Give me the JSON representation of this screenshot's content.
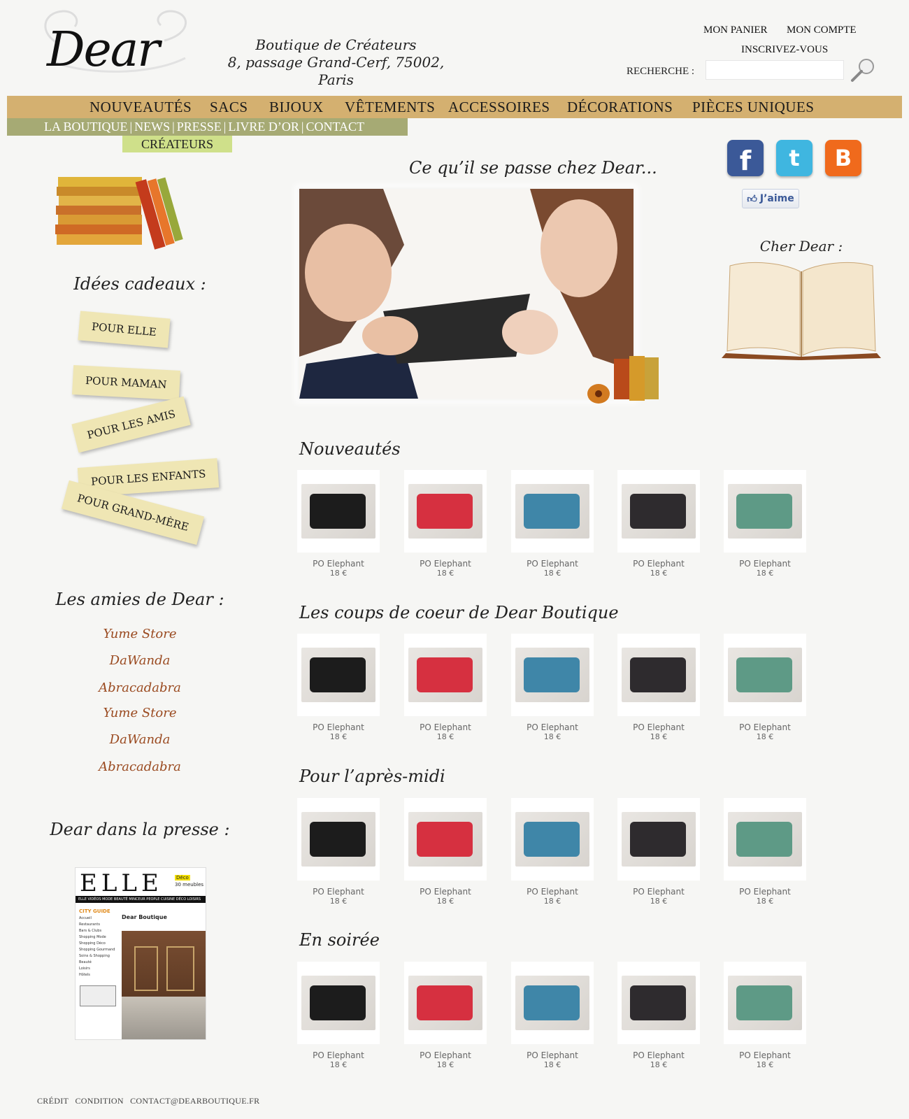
{
  "header": {
    "tagline_line1": "Boutique de Créateurs",
    "tagline_line2": "8, passage Grand-Cerf, 75002, Paris",
    "cart_label": "MON PANIER",
    "account_label": "MON COMPTE",
    "signup_label": "INSCRIVEZ-VOUS",
    "search_label": "RECHERCHE :",
    "search_value": "",
    "search_icon": "magnifier-icon"
  },
  "main_nav": [
    "NOUVEAUTÉS",
    "SACS",
    "BIJOUX",
    "VÊTEMENTS",
    "ACCESSOIRES",
    "DÉCORATIONS",
    "PIÈCES UNIQUES"
  ],
  "sub_nav": [
    "LA BOUTIQUE",
    "NEWS",
    "PRESSE",
    "LIVRE D’OR",
    "CONTACT"
  ],
  "sub_nav_extra": "CRÉATEURS",
  "left": {
    "gift_heading": "Idées cadeaux :",
    "gift_tags": [
      "POUR ELLE",
      "POUR MAMAN",
      "POUR LES AMIS",
      "POUR LES ENFANTS",
      "POUR GRAND-MÈRE"
    ],
    "friends_heading": "Les amies de Dear :",
    "friends": [
      "Yume Store",
      "DaWanda",
      "Abracadabra",
      "Yume Store",
      "DaWanda",
      "Abracadabra"
    ],
    "press_heading": "Dear dans la presse :",
    "press": {
      "magazine": "ELLE",
      "badge_top": "Déco",
      "badge_bottom": "30 meubles",
      "menu": "ELLE VIDÉOS  MODE  BEAUTÉ  MINCEUR  PEOPLE  CUISINE  DÉCO  LOISIRS",
      "city_guide": "CITY GUIDE",
      "article_title": "Dear Boutique",
      "side_links": [
        "Accueil",
        "Restaurants",
        "Bars & Clubs",
        "Shopping Mode",
        "Shopping Déco",
        "Shopping Gourmand",
        "Soins & Shopping Beauté",
        "Loisirs",
        "Hôtels"
      ]
    }
  },
  "center": {
    "heading": "Ce qu’il se passe chez Dear...",
    "sections": [
      {
        "title": "Nouveautés"
      },
      {
        "title": "Les coups de coeur de Dear Boutique"
      },
      {
        "title": "Pour l’après-midi"
      },
      {
        "title": "En soirée"
      }
    ],
    "product_name": "PO Elephant",
    "product_price": "18 €",
    "product_colors": [
      "#1c1c1c",
      "#d63040",
      "#3f86a8",
      "#2e2b2e",
      "#5e9a86"
    ]
  },
  "right": {
    "social_icons": [
      "facebook-icon",
      "twitter-icon",
      "blogger-icon"
    ],
    "like_label": "J’aime",
    "guestbook_heading": "Cher Dear :"
  },
  "footer": {
    "links": [
      "CRÉDIT",
      "CONDITION",
      "CONTACT@DEARBOUTIQUE.FR"
    ]
  },
  "colors": {
    "nav_bg": "#d4b070",
    "subnav_bg": "#a6aa74",
    "createurs_bg": "#cfe08a",
    "friend_link": "#9a4a20"
  }
}
